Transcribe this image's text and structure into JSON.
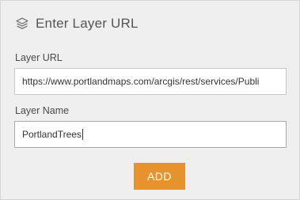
{
  "dialog": {
    "title": "Enter Layer URL",
    "icon": "layers-icon"
  },
  "layer_url": {
    "label": "Layer URL",
    "value": "https://www.portlandmaps.com/arcgis/rest/services/Publi"
  },
  "layer_name": {
    "label": "Layer Name",
    "value": "PortlandTrees"
  },
  "actions": {
    "add_label": "ADD"
  },
  "colors": {
    "accent": "#e8922e",
    "background": "#efefef"
  }
}
